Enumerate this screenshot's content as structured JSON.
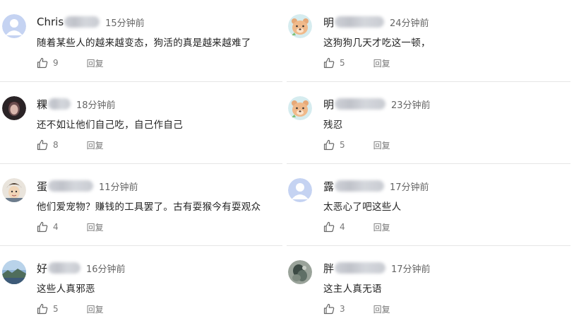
{
  "colors": {
    "divider": "#e6e6e6",
    "text": "#222222",
    "meta": "#666666",
    "action": "#777777",
    "default_avatar": "#c5d3f2"
  },
  "comments": [
    {
      "username": "Chris",
      "time": "15分钟前",
      "text": "随着某些人的越来越变态，狗活的真是越来越难了",
      "likes": "9",
      "reply": "回复",
      "avatar": "default-avatar"
    },
    {
      "username": "粿",
      "time": "18分钟前",
      "text": "还不如让他们自己吃，自己作自己",
      "likes": "8",
      "reply": "回复",
      "avatar": "dark-portrait-avatar"
    },
    {
      "username": "蛋",
      "time": "11分钟前",
      "text": "他们爱宠物？赚钱的工具罢了。古有耍猴今有耍观众",
      "likes": "4",
      "reply": "回复",
      "avatar": "cartoon-face-avatar"
    },
    {
      "username": "好",
      "time": "16分钟前",
      "text": "这些人真邪恶",
      "likes": "5",
      "reply": "回复",
      "avatar": "landscape-avatar"
    },
    {
      "username": "明",
      "time": "24分钟前",
      "text": "这狗狗几天才吃这一顿，",
      "likes": "5",
      "reply": "回复",
      "avatar": "bear-avatar"
    },
    {
      "username": "明",
      "time": "23分钟前",
      "text": "残忍",
      "likes": "5",
      "reply": "回复",
      "avatar": "bear-avatar"
    },
    {
      "username": "露",
      "time": "17分钟前",
      "text": "太恶心了吧这些人",
      "likes": "4",
      "reply": "回复",
      "avatar": "default-avatar"
    },
    {
      "username": "胖",
      "time": "17分钟前",
      "text": "这主人真无语",
      "likes": "3",
      "reply": "回复",
      "avatar": "photo-avatar"
    }
  ]
}
